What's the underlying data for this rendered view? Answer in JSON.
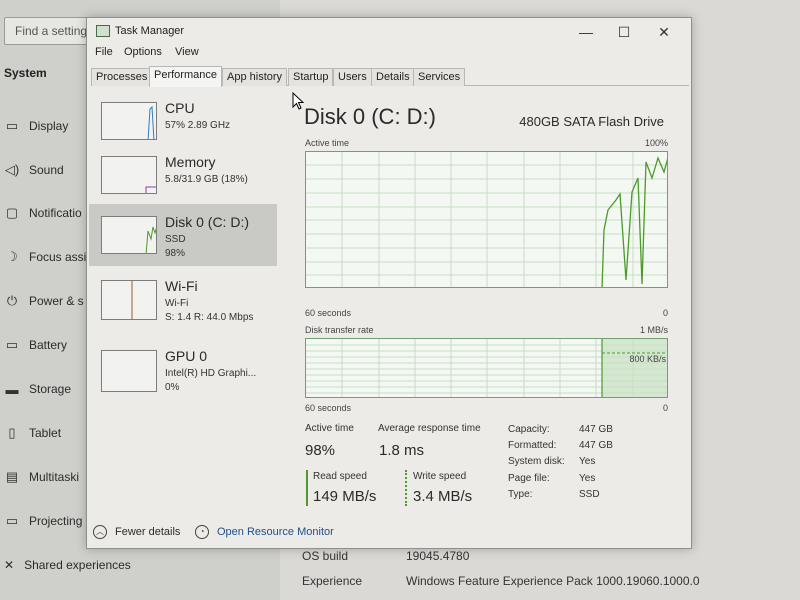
{
  "settings_bg": {
    "search_placeholder": "Find a setting",
    "section": "System",
    "nav_items": [
      {
        "label": "Display",
        "icon": "display-icon"
      },
      {
        "label": "Sound",
        "icon": "sound-icon"
      },
      {
        "label": "Notificatio",
        "icon": "notification-icon"
      },
      {
        "label": "Focus assi",
        "icon": "focus-assist-icon"
      },
      {
        "label": "Power & s",
        "icon": "power-icon"
      },
      {
        "label": "Battery",
        "icon": "battery-icon"
      },
      {
        "label": "Storage",
        "icon": "storage-icon"
      },
      {
        "label": "Tablet",
        "icon": "tablet-icon"
      },
      {
        "label": "Multitaski",
        "icon": "multitasking-icon"
      },
      {
        "label": "Projecting",
        "icon": "projecting-icon"
      }
    ],
    "shared": "Shared experiences",
    "os_build_label": "OS build",
    "os_build_value": "19045.4780",
    "experience_label": "Experience",
    "experience_value": "Windows Feature Experience Pack 1000.19060.1000.0"
  },
  "task_manager": {
    "title": "Task Manager",
    "controls": {
      "minimize": "—",
      "maximize": "☐",
      "close": "✕"
    },
    "menu": [
      "File",
      "Options",
      "View"
    ],
    "tabs": [
      "Processes",
      "Performance",
      "App history",
      "Startup",
      "Users",
      "Details",
      "Services"
    ],
    "active_tab": "Performance",
    "resources": [
      {
        "title": "CPU",
        "sub1": "57% 2.89 GHz",
        "sub2": "",
        "color": "#2f7fc1"
      },
      {
        "title": "Memory",
        "sub1": "5.8/31.9 GB (18%)",
        "sub2": "",
        "color": "#8b3fa8"
      },
      {
        "title": "Disk 0 (C: D:)",
        "sub1": "SSD",
        "sub2": "98%",
        "color": "#4c9a2a"
      },
      {
        "title": "Wi-Fi",
        "sub1": "Wi-Fi",
        "sub2": "S: 1.4  R: 44.0 Mbps",
        "color": "#a05a2c"
      },
      {
        "title": "GPU 0",
        "sub1": "Intel(R) HD Graphi...",
        "sub2": "0%",
        "color": "#2f7fc1"
      }
    ],
    "selected_resource": "Disk 0 (C: D:)",
    "detail": {
      "title": "Disk 0 (C: D:)",
      "model": "480GB SATA Flash Drive",
      "active_time_label": "Active time",
      "active_time_max": "100%",
      "time_span": "60 seconds",
      "zero": "0",
      "transfer_label": "Disk transfer rate",
      "transfer_max": "1 MB/s",
      "transfer_mark": "800 KB/s",
      "stats": {
        "active_time_label": "Active time",
        "active_time_value": "98%",
        "avg_resp_label": "Average response time",
        "avg_resp_value": "1.8 ms",
        "read_label": "Read speed",
        "read_value": "149 MB/s",
        "write_label": "Write speed",
        "write_value": "3.4 MB/s"
      },
      "properties": [
        {
          "key": "Capacity:",
          "value": "447 GB"
        },
        {
          "key": "Formatted:",
          "value": "447 GB"
        },
        {
          "key": "System disk:",
          "value": "Yes"
        },
        {
          "key": "Page file:",
          "value": "Yes"
        },
        {
          "key": "Type:",
          "value": "SSD"
        }
      ]
    },
    "footer": {
      "fewer_details": "Fewer details",
      "open_resource_monitor": "Open Resource Monitor"
    },
    "accent_color": "#4c9a2a"
  }
}
